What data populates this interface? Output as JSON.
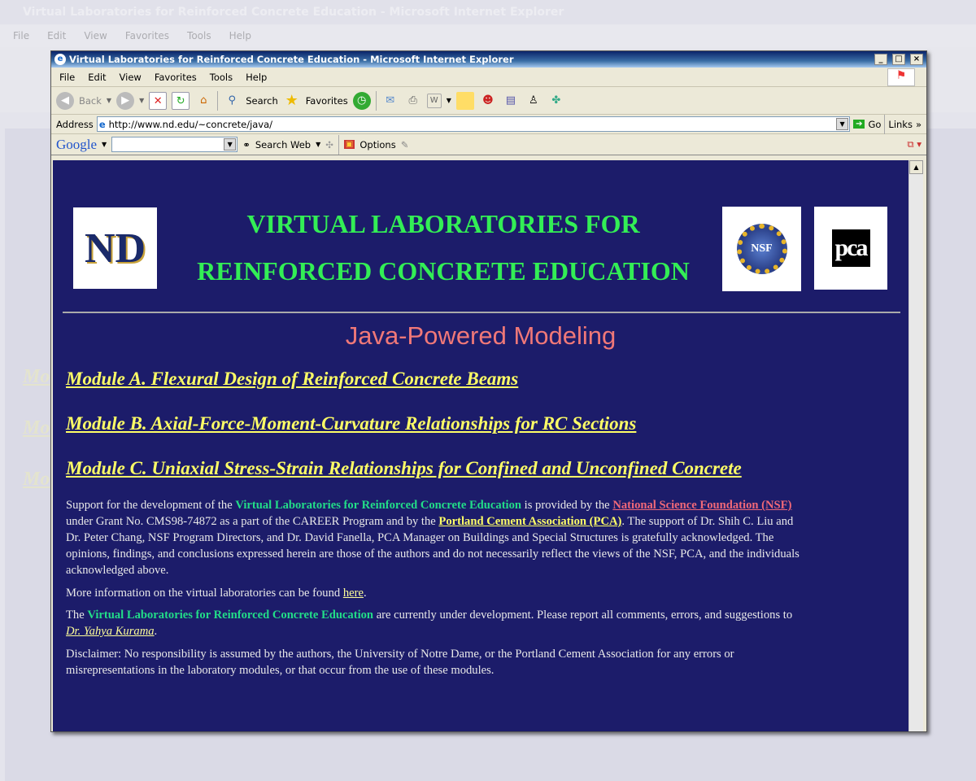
{
  "background_window": {
    "title": "Virtual Laboratories for Reinforced Concrete Education - Microsoft Internet Explorer",
    "menu": [
      "File",
      "Edit",
      "View",
      "Favorites",
      "Tools",
      "Help"
    ],
    "module_fragments": [
      "Mo",
      "Mo",
      "Mo"
    ]
  },
  "window": {
    "title": "Virtual Laboratories for Reinforced Concrete Education - Microsoft Internet Explorer",
    "controls": [
      "_",
      "□",
      "×"
    ]
  },
  "menu": [
    "File",
    "Edit",
    "View",
    "Favorites",
    "Tools",
    "Help"
  ],
  "toolbar": {
    "back": "Back",
    "search": "Search",
    "favorites": "Favorites"
  },
  "address": {
    "label": "Address",
    "url": "http://www.nd.edu/~concrete/java/",
    "go": "Go",
    "links": "Links"
  },
  "google_bar": {
    "brand": "Google",
    "search_value": "",
    "search_web": "Search Web",
    "options": "Options"
  },
  "page": {
    "title_line1": "VIRTUAL LABORATORIES FOR",
    "title_line2": "REINFORCED CONCRETE EDUCATION",
    "logo_nd": "ND",
    "logo_nsf": "NSF",
    "logo_pca": "pca",
    "subtitle": "Java-Powered Modeling",
    "modules": [
      "Module A. Flexural Design of Reinforced Concrete Beams",
      "Module B. Axial-Force-Moment-Curvature Relationships for RC Sections",
      "Module C. Uniaxial Stress-Strain Relationships for Confined and Unconfined Concrete"
    ],
    "support": {
      "t1": "Support for the development of the ",
      "vl": "Virtual Laboratories for Reinforced Concrete Education",
      "t2": " is provided by the ",
      "nsf": "National Science Foundation (NSF)",
      "t3": " under Grant No. CMS98-74872 as a part of the CAREER Program and by the ",
      "pca": "Portland Cement Association (PCA)",
      "t4": ". The support of Dr. Shih C. Liu and Dr. Peter Chang, NSF Program Directors, and Dr. David Fanella, PCA Manager on Buildings and Special Structures is gratefully acknowledged. The opinions, findings, and conclusions expressed herein are those of the authors and do not necessarily reflect the views of the NSF, PCA, and the individuals acknowledged above."
    },
    "more": {
      "t1": "More information on the virtual laboratories can be found ",
      "link": "here",
      "t2": "."
    },
    "dev": {
      "t1": "The ",
      "vl": "Virtual Laboratories for Reinforced Concrete Education",
      "t2": " are currently under development. Please report all comments, errors, and suggestions to ",
      "link": "Dr. Yahya Kurama",
      "t3": "."
    },
    "disclaimer": "Disclaimer: No responsibility is assumed by the authors, the University of Notre Dame, or the Portland Cement Association for any errors or misrepresentations in the laboratory modules, or that occur from the use of these modules."
  },
  "colors": {
    "page_bg": "#1c1c6a",
    "title_green": "#33ee55",
    "subtitle": "#f07878",
    "link_yellow": "#ffff66",
    "highlight_green": "#22dd88"
  }
}
